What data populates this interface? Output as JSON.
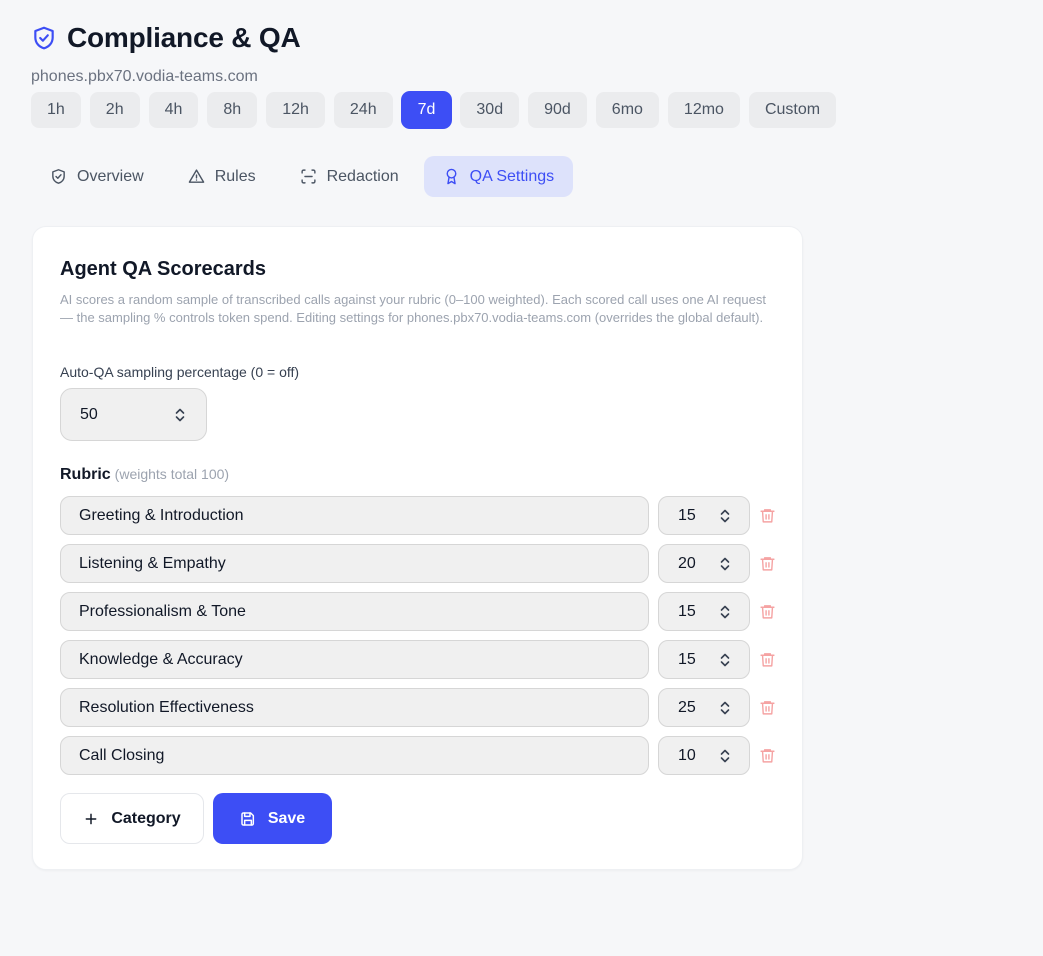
{
  "header": {
    "title": "Compliance & QA",
    "domain": "phones.pbx70.vodia-teams.com"
  },
  "ranges": [
    "1h",
    "2h",
    "4h",
    "8h",
    "12h",
    "24h",
    "7d",
    "30d",
    "90d",
    "6mo",
    "12mo",
    "Custom"
  ],
  "active_range": "7d",
  "tabs": [
    {
      "label": "Overview",
      "icon": "shield-check-icon"
    },
    {
      "label": "Rules",
      "icon": "warning-triangle-icon"
    },
    {
      "label": "Redaction",
      "icon": "scan-icon"
    },
    {
      "label": "QA Settings",
      "icon": "award-icon"
    }
  ],
  "active_tab": "QA Settings",
  "card": {
    "title": "Agent QA Scorecards",
    "description": "AI scores a random sample of transcribed calls against your rubric (0–100 weighted). Each scored call uses one AI request — the sampling % controls token spend. Editing settings for phones.pbx70.vodia-teams.com (overrides the global default).",
    "sampling_label": "Auto-QA sampling percentage (0 = off)",
    "sampling_value": "50",
    "rubric_label": "Rubric",
    "rubric_hint": "(weights total 100)",
    "rubric": [
      {
        "name": "Greeting & Introduction",
        "weight": "15"
      },
      {
        "name": "Listening & Empathy",
        "weight": "20"
      },
      {
        "name": "Professionalism & Tone",
        "weight": "15"
      },
      {
        "name": "Knowledge & Accuracy",
        "weight": "15"
      },
      {
        "name": "Resolution Effectiveness",
        "weight": "25"
      },
      {
        "name": "Call Closing",
        "weight": "10"
      }
    ],
    "add_label": "Category",
    "save_label": "Save"
  },
  "colors": {
    "accent": "#3d4ef5",
    "accent_soft": "#dde2fb",
    "danger_soft": "#f5a3a3",
    "background": "#f6f7f9"
  }
}
